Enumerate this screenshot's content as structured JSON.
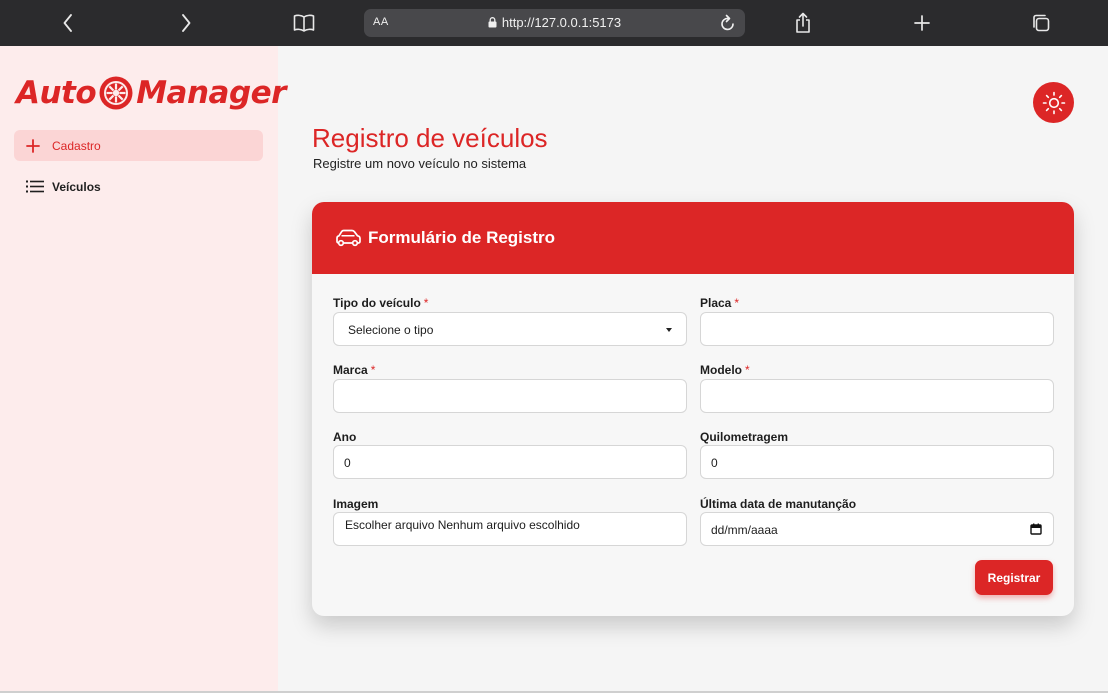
{
  "browser": {
    "url": "http://127.0.0.1:5173",
    "text_size_label": "AA",
    "icons": [
      "back-icon",
      "forward-icon",
      "bookmarks-icon",
      "reload-icon",
      "share-icon",
      "new-tab-icon",
      "tabs-icon"
    ]
  },
  "brand": {
    "name_left": "Auto",
    "name_right": "Manager",
    "accent_color": "#dc2626"
  },
  "sidebar": {
    "items": [
      {
        "label": "Cadastro",
        "icon": "plus-icon",
        "active": true
      },
      {
        "label": "Veículos",
        "icon": "list-icon",
        "active": false
      }
    ]
  },
  "page": {
    "title": "Registro de veículos",
    "subtitle": "Registre um novo veículo no sistema",
    "theme_toggle_icon": "sun-icon"
  },
  "form": {
    "header_title": "Formulário de Registro",
    "header_icon": "car-icon",
    "required_mark": "*",
    "fields": {
      "tipo": {
        "label": "Tipo do veículo",
        "value": "Selecione o tipo"
      },
      "placa": {
        "label": "Placa",
        "value": ""
      },
      "marca": {
        "label": "Marca",
        "value": ""
      },
      "modelo": {
        "label": "Modelo",
        "value": ""
      },
      "ano": {
        "label": "Ano",
        "value": "0"
      },
      "quilometragem": {
        "label": "Quilometragem",
        "value": "0"
      },
      "imagem": {
        "label": "Imagem",
        "value": "Escolher arquivo Nenhum arquivo escolhido"
      },
      "manutencao": {
        "label": "Última data de manutanção",
        "value": "dd/mm/aaaa"
      }
    },
    "submit_label": "Registrar"
  }
}
